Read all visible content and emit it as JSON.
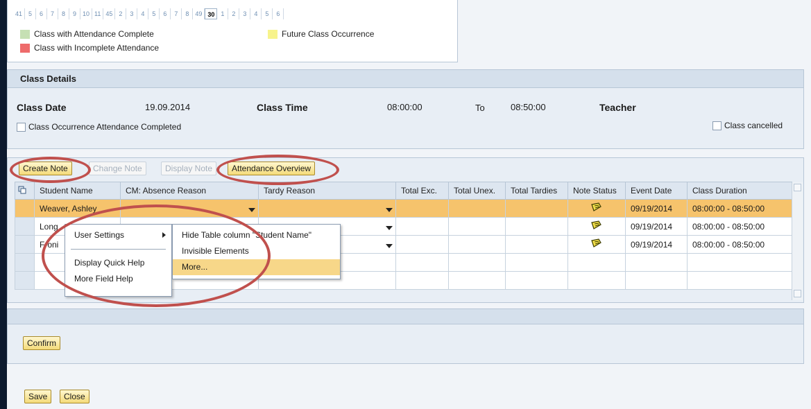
{
  "calendar": {
    "weeks": [
      "41",
      "5",
      "6",
      "7",
      "8",
      "9",
      "10",
      "11",
      "45",
      "2",
      "3",
      "4",
      "5",
      "6",
      "7",
      "8",
      "49",
      "30",
      "1",
      "2",
      "3",
      "4",
      "5",
      "6"
    ],
    "selected": "30",
    "legend": {
      "complete": "Class with Attendance Complete",
      "incomplete": "Class with Incomplete Attendance",
      "future": "Future Class Occurrence"
    },
    "colors": {
      "complete": "#c6e0b4",
      "incomplete": "#ee6b6b",
      "future": "#f7f38c"
    }
  },
  "details": {
    "title": "Class Details",
    "class_date_label": "Class Date",
    "class_date": "19.09.2014",
    "class_time_label": "Class Time",
    "time_from": "08:00:00",
    "to_label": "To",
    "time_to": "08:50:00",
    "teacher_label": "Teacher",
    "attendance_completed_label": "Class Occurrence Attendance Completed",
    "cancelled_label": "Class cancelled"
  },
  "toolbar": {
    "create_note": "Create Note",
    "change_note": "Change Note",
    "display_note": "Display Note",
    "attendance_overview": "Attendance Overview"
  },
  "table": {
    "columns": [
      "Student Name",
      "CM: Absence Reason",
      "Tardy Reason",
      "Total Exc.",
      "Total Unex.",
      "Total Tardies",
      "Note Status",
      "Event Date",
      "Class Duration"
    ],
    "rows": [
      {
        "name": "Weaver, Ashley",
        "event_date": "09/19/2014",
        "duration": "08:00:00 - 08:50:00"
      },
      {
        "name": "Long",
        "event_date": "09/19/2014",
        "duration": "08:00:00 - 08:50:00"
      },
      {
        "name": "Froni",
        "event_date": "09/19/2014",
        "duration": "08:00:00 - 08:50:00"
      }
    ]
  },
  "context_menu": {
    "user_settings": "User Settings",
    "display_quick_help": "Display Quick Help",
    "more_field_help": "More Field Help",
    "submenu": {
      "hide_column": "Hide Table column \"Student Name\"",
      "invisible_elements": "Invisible Elements",
      "more": "More..."
    }
  },
  "confirm_label": "Confirm",
  "footer": {
    "save": "Save",
    "close": "Close"
  },
  "accent_colors": {
    "highlight_row": "#f6c36c",
    "annotation": "#c0504d"
  }
}
